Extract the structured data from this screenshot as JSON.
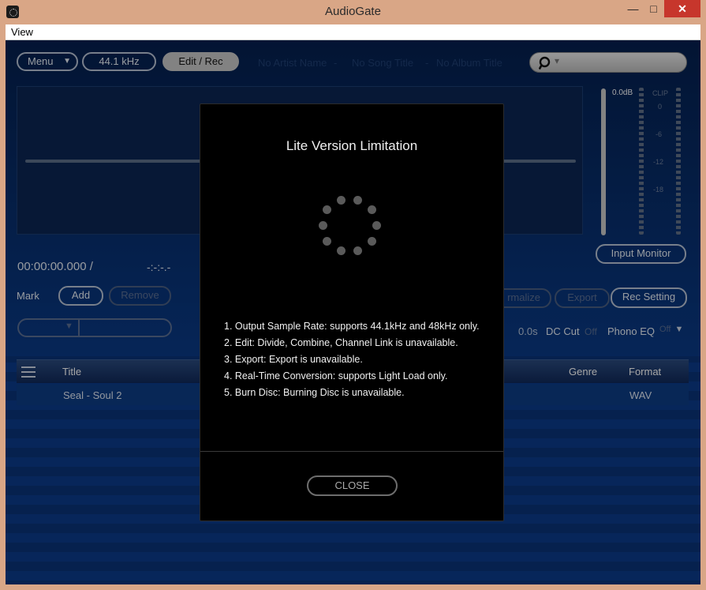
{
  "window": {
    "title": "AudioGate",
    "min_glyph": "—",
    "max_glyph": "□",
    "close_glyph": "✕"
  },
  "menubar": {
    "view": "View"
  },
  "toolbar": {
    "menu_label": "Menu",
    "menu_arrow": "▼",
    "sample_rate": "44.1 kHz",
    "edit_rec": "Edit / Rec",
    "artist": "No Artist Name",
    "song": "No Song Title",
    "album": "No Album Title",
    "sep1": "-",
    "sep2": "-",
    "search_icon": "search-icon",
    "search_arrow": "▾"
  },
  "meter": {
    "db_label": "0.0dB",
    "clip_label": "CLIP",
    "scale": [
      "0",
      "-6",
      "-12",
      "-18"
    ]
  },
  "transport": {
    "time": "00:00:00.000 /",
    "total": "-:-:-.-"
  },
  "mark": {
    "label": "Mark",
    "add": "Add",
    "remove": "Remove"
  },
  "actions": {
    "normalize": "rmalize",
    "export": "Export",
    "rec_setting": "Rec Setting",
    "input_monitor": "Input Monitor"
  },
  "settings": {
    "fade": "0.0s",
    "dc_cut": "DC Cut",
    "dc_cut_state": "Off",
    "phono_eq": "Phono EQ",
    "phono_eq_state": "Off",
    "phono_arrow": "▼",
    "combo_arrow": "▼"
  },
  "list": {
    "columns": {
      "title": "Title",
      "genre": "Genre",
      "format": "Format"
    },
    "rows": [
      {
        "title": "Seal - Soul 2",
        "format": "WAV"
      }
    ]
  },
  "modal": {
    "title": "Lite Version Limitation",
    "items": [
      "1. Output Sample Rate: supports 44.1kHz and 48kHz only.",
      "2. Edit: Divide, Combine, Channel Link is unavailable.",
      "3. Export: Export is unavailable.",
      "4. Real-Time Conversion: supports Light Load only.",
      "5. Burn Disc: Burning Disc is unavailable."
    ],
    "close": "CLOSE"
  }
}
